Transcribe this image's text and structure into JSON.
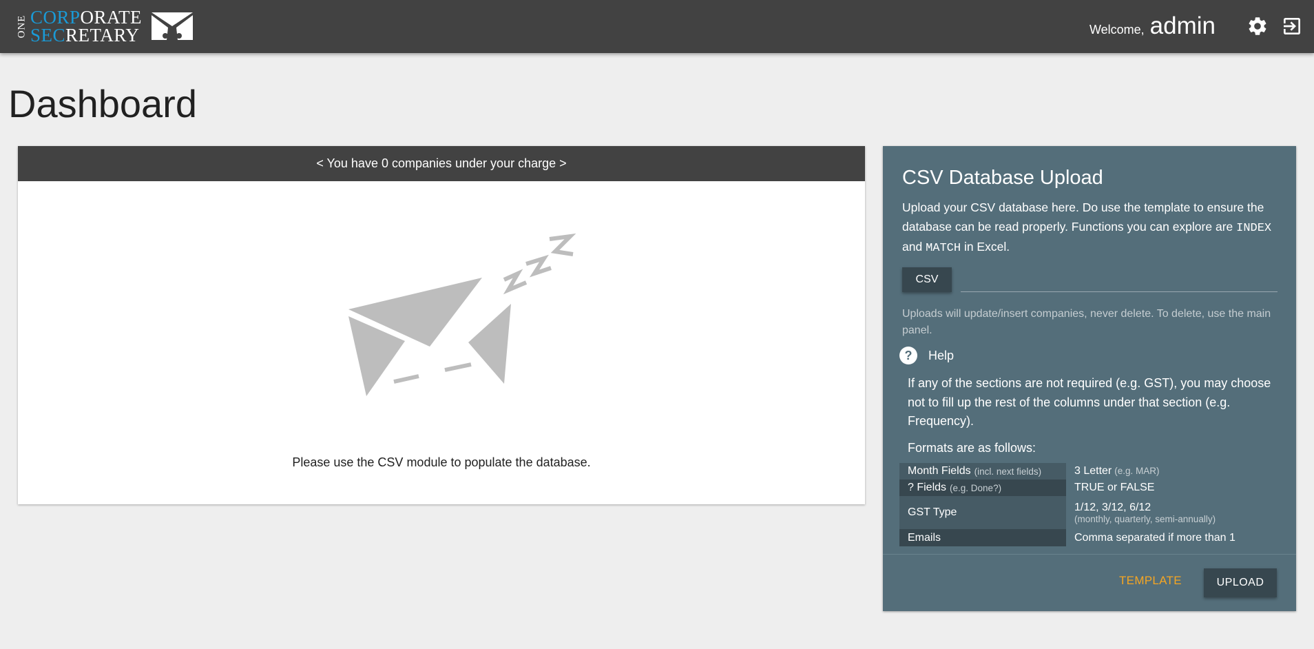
{
  "brand": {
    "one": "ONE",
    "line1_blue": "CORP",
    "line1_rest": "ORATE",
    "line2_blue": "SEC",
    "line2_rest": "RETARY",
    "blue": "#1a9ad6",
    "icon": "envelope-logo-icon"
  },
  "header": {
    "welcome_label": "Welcome,",
    "username": "admin",
    "settings_icon": "gear-icon",
    "logout_icon": "exit-icon"
  },
  "page": {
    "title": "Dashboard"
  },
  "companies_panel": {
    "header": "< You have 0 companies under your charge >",
    "graphic": "sleeping-envelope-icon",
    "empty_message": "Please use the CSV module to populate the database."
  },
  "upload_panel": {
    "title": "CSV Database Upload",
    "desc_part1": "Upload your CSV database here. Do use the template to ensure the database can be read properly. Functions you can explore are ",
    "code1": "INDEX",
    "desc_and": " and ",
    "code2": "MATCH",
    "desc_part2": " in Excel.",
    "csv_button": "CSV",
    "file_path_value": "",
    "note": "Uploads will update/insert companies, never delete. To delete, use the main panel.",
    "help_label": "Help",
    "help_icon": "?",
    "help_text": "If any of the sections are not required (e.g. GST), you may choose not to fill up the rest of the columns under that section (e.g. Frequency).",
    "formats_label": "Formats are as follows:",
    "formats": [
      {
        "key": "Month Fields",
        "key_sub": "(incl. next fields)",
        "val": "3 Letter",
        "val_sub": "(e.g. MAR)",
        "val_line2": ""
      },
      {
        "key": "? Fields",
        "key_sub": "(e.g. Done?)",
        "val": "TRUE or FALSE",
        "val_sub": "",
        "val_line2": ""
      },
      {
        "key": "GST Type",
        "key_sub": "",
        "val": "1/12, 3/12, 6/12",
        "val_sub": "",
        "val_line2": "(monthly, quarterly, semi-annually)"
      },
      {
        "key": "Emails",
        "key_sub": "",
        "val": "Comma separated if more than 1",
        "val_sub": "",
        "val_line2": ""
      }
    ],
    "template_link": "TEMPLATE",
    "upload_button": "UPLOAD",
    "colors": {
      "panel": "#546e7a",
      "accent": "#f5a623",
      "button": "#37474f"
    }
  }
}
